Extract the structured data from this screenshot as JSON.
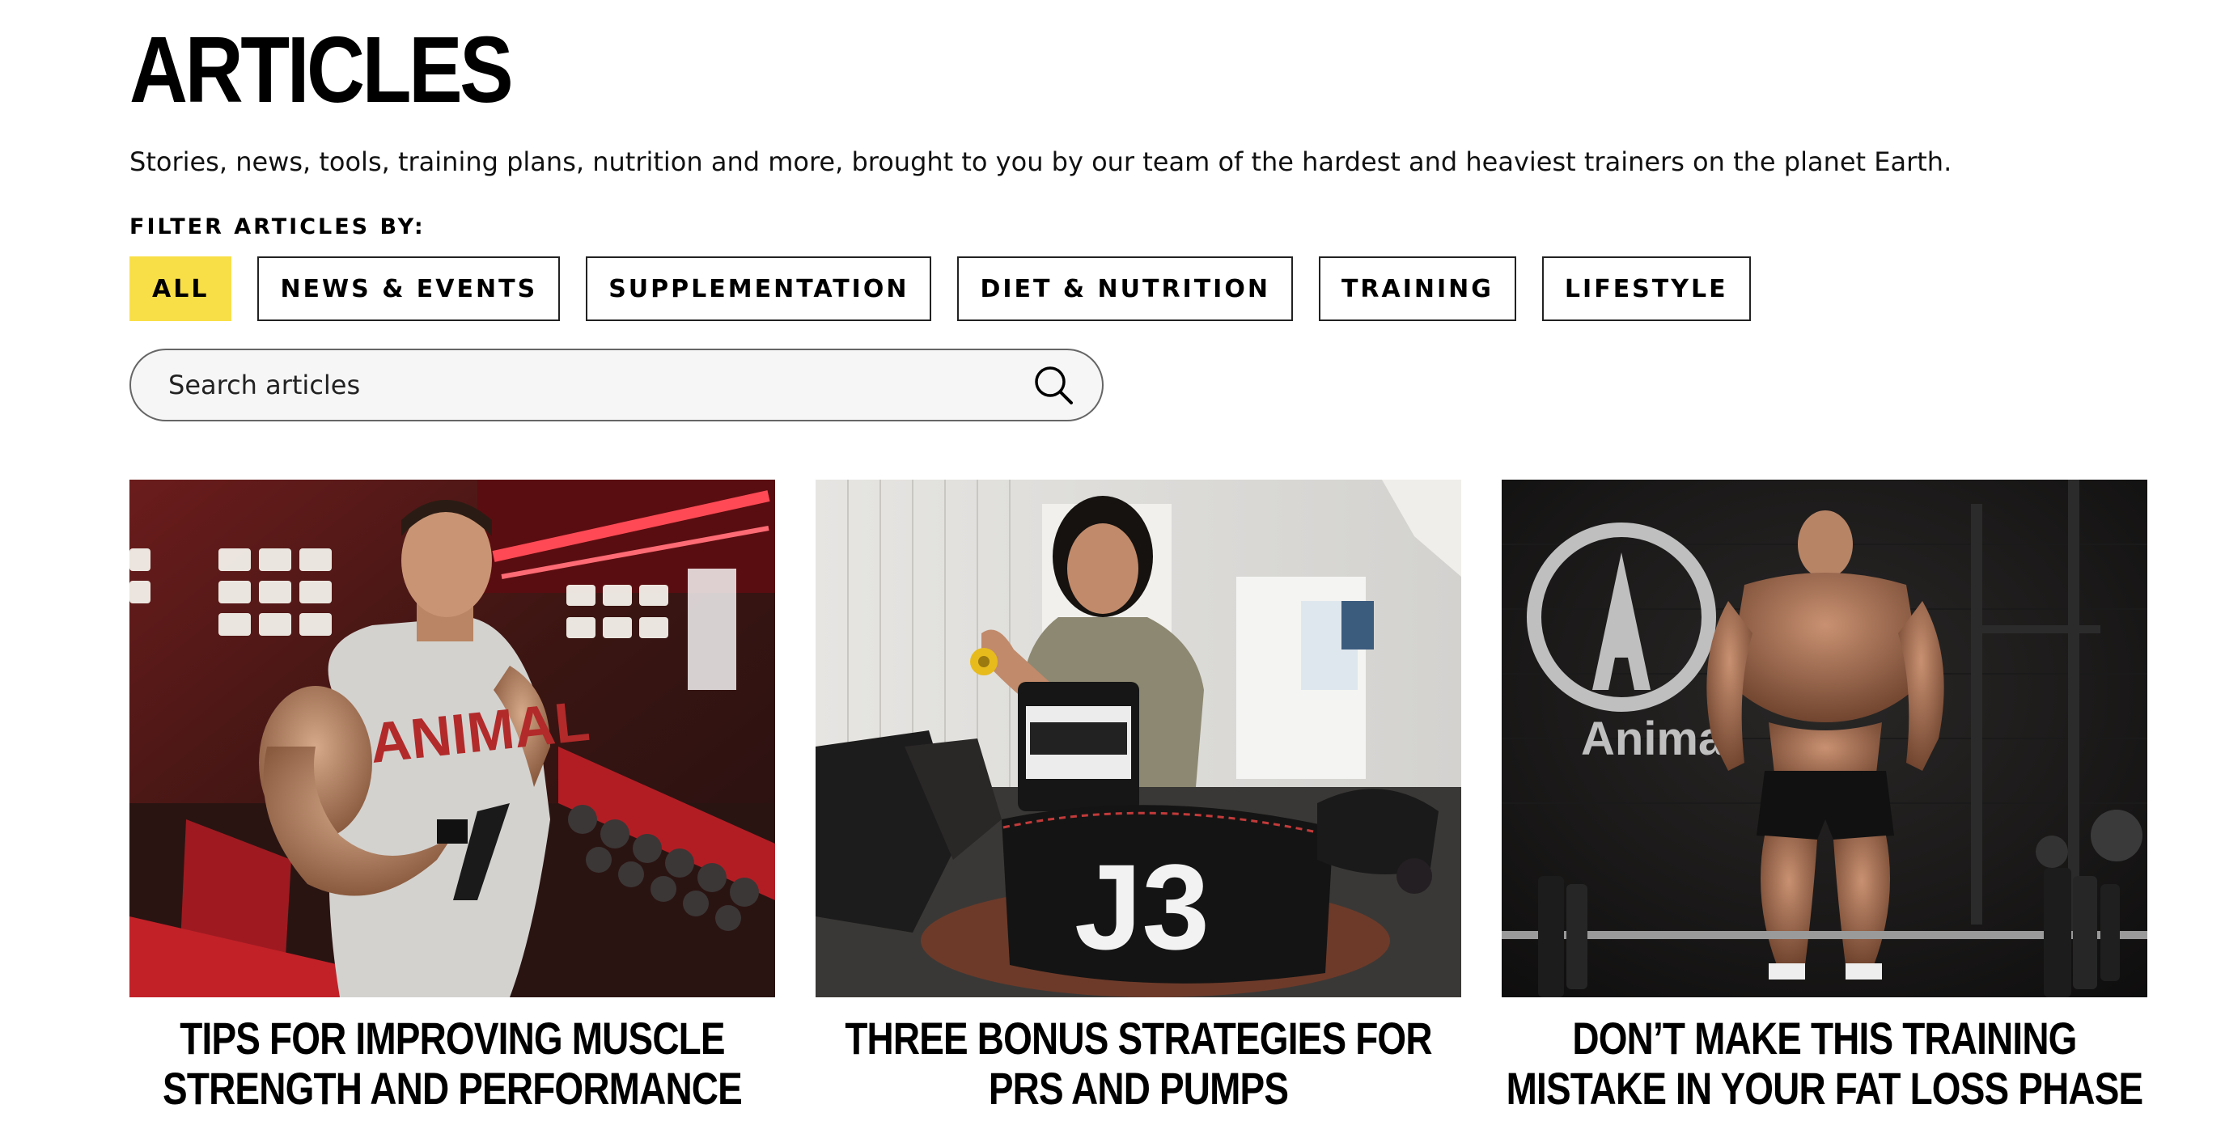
{
  "page": {
    "title": "ARTICLES",
    "intro": "Stories, news, tools, training plans, nutrition and more, brought to you by our team of the hardest and heaviest trainers on the planet Earth."
  },
  "filters": {
    "label": "FILTER ARTICLES BY:",
    "options": [
      {
        "label": "ALL",
        "active": true
      },
      {
        "label": "NEWS & EVENTS",
        "active": false
      },
      {
        "label": "SUPPLEMENTATION",
        "active": false
      },
      {
        "label": "DIET & NUTRITION",
        "active": false
      },
      {
        "label": "TRAINING",
        "active": false
      },
      {
        "label": "LIFESTYLE",
        "active": false
      }
    ]
  },
  "search": {
    "placeholder": "Search articles",
    "value": "",
    "icon": "search-icon"
  },
  "articles": [
    {
      "title": "TIPS FOR IMPROVING MUSCLE STRENGTH AND PERFORMANCE",
      "image": "bodybuilder-in-gym-photo",
      "image_text": "ANIMAL"
    },
    {
      "title": "THREE BONUS STRATEGIES FOR PRS AND PUMPS",
      "image": "woman-with-supplements-and-lifting-belt-photo",
      "image_text": "J3"
    },
    {
      "title": "DON’T MAKE THIS TRAINING MISTAKE IN YOUR FAT LOSS PHASE",
      "image": "athlete-with-barbell-photo",
      "image_text": "Animal"
    }
  ],
  "colors": {
    "accent": "#f9df47",
    "text": "#000000",
    "border": "#222222"
  }
}
